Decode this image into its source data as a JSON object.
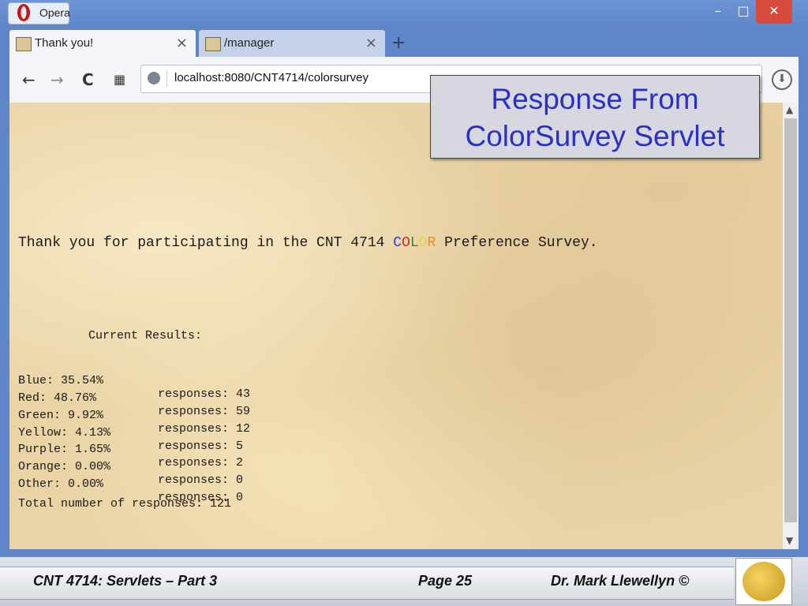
{
  "window": {
    "app_name": "Opera",
    "minimize_glyph": "–",
    "maximize_glyph": "□",
    "close_glyph": "✕"
  },
  "tabs": [
    {
      "label": "Thank you!",
      "close": "×"
    },
    {
      "label": "/manager",
      "close": "×"
    }
  ],
  "new_tab_glyph": "+",
  "toolbar": {
    "back_glyph": "←",
    "forward_glyph": "→",
    "reload_glyph": "C",
    "speeddial_glyph": "▦",
    "address": "localhost:8080/CNT4714/colorsurvey",
    "download_glyph": "⬇"
  },
  "page": {
    "thanks_before": "Thank you for participating in the CNT 4714 ",
    "color_letters": [
      "C",
      "O",
      "L",
      "O",
      "R"
    ],
    "thanks_after": " Preference Survey.",
    "results_title": "Current Results:",
    "results": [
      {
        "color": "Blue: 35.54%",
        "responses": "responses: 43"
      },
      {
        "color": "Red: 48.76%",
        "responses": "responses: 59"
      },
      {
        "color": "Green: 9.92%",
        "responses": "responses: 12"
      },
      {
        "color": "Yellow: 4.13%",
        "responses": "responses: 5"
      },
      {
        "color": "Purple: 1.65%",
        "responses": "responses: 2"
      },
      {
        "color": "Orange: 0.00%",
        "responses": "responses: 0"
      },
      {
        "color": "Other: 0.00%",
        "responses": "responses: 0"
      }
    ],
    "total": "Total number of responses: 121"
  },
  "callout": {
    "line1": "Response From",
    "line2": "ColorSurvey Servlet"
  },
  "footer": {
    "left": "CNT 4714: Servlets – Part 3",
    "middle": "Page 25",
    "right": "Dr. Mark Llewellyn ©"
  },
  "colors": {
    "title_bar": "#5f86c8",
    "close_button": "#d84a3b",
    "callout_text": "#2b2fc9",
    "page_background": "#ead4a6"
  }
}
